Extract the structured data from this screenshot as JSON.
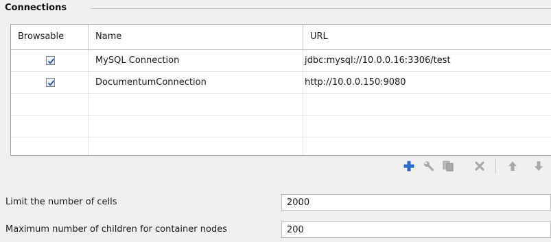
{
  "group": {
    "title": "Connections"
  },
  "table": {
    "columns": [
      "Browsable",
      "Name",
      "URL"
    ],
    "rows": [
      {
        "browsable": true,
        "name": "MySQL Connection",
        "url": "jdbc:mysql://10.0.0.16:3306/test"
      },
      {
        "browsable": true,
        "name": "DocumentumConnection",
        "url": "http://10.0.0.150:9080"
      }
    ]
  },
  "toolbar": {
    "buttons": [
      {
        "name": "add-icon",
        "enabled": true
      },
      {
        "name": "wrench-icon",
        "enabled": false
      },
      {
        "name": "copy-icon",
        "enabled": false
      },
      {
        "name": "delete-icon",
        "enabled": false
      },
      {
        "name": "move-up-icon",
        "enabled": false
      },
      {
        "name": "move-down-icon",
        "enabled": false
      }
    ]
  },
  "settings": {
    "limit_cells": {
      "label": "Limit the number of cells",
      "value": "2000"
    },
    "max_children": {
      "label": "Maximum number of children for container nodes",
      "value": "200"
    }
  },
  "colors": {
    "add_icon": "#2a6fd6",
    "disabled_icon": "#a9a9a9",
    "check_mark": "#1f4f9a"
  }
}
